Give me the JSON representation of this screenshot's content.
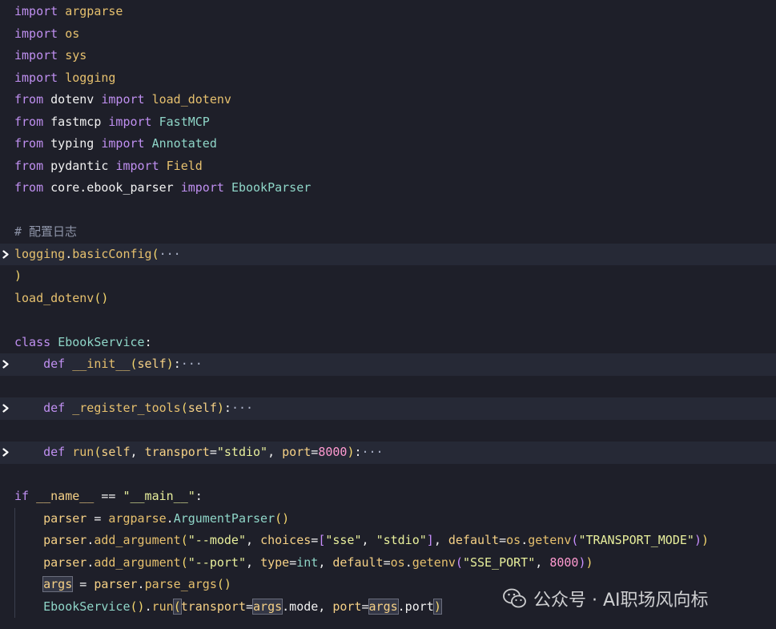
{
  "theme": {
    "background": "#1e1f29",
    "highlight_line": "#262936",
    "keyword": "#bf8ff0",
    "text": "#f1f1f1",
    "module": "#e6c06e",
    "class_name": "#8fd6c8",
    "function": "#e6c06e",
    "parameter": "#f6d186",
    "string": "#e8ef9c",
    "number": "#ff9ad0",
    "comment": "#8e94a8",
    "builtin": "#8fd6c8",
    "operator": "#f1f1f1",
    "bracket": "#f5d76e",
    "bracket_inner": "#c98fff",
    "bracket_innermost": "#5fb3ff"
  },
  "lines": [
    {
      "fold": false,
      "indent": 0,
      "tokens": [
        {
          "t": "import",
          "c": "keyword"
        },
        {
          "t": " "
        },
        {
          "t": "argparse",
          "c": "module"
        }
      ]
    },
    {
      "fold": false,
      "indent": 0,
      "tokens": [
        {
          "t": "import",
          "c": "keyword"
        },
        {
          "t": " "
        },
        {
          "t": "os",
          "c": "module"
        }
      ]
    },
    {
      "fold": false,
      "indent": 0,
      "tokens": [
        {
          "t": "import",
          "c": "keyword"
        },
        {
          "t": " "
        },
        {
          "t": "sys",
          "c": "module"
        }
      ]
    },
    {
      "fold": false,
      "indent": 0,
      "tokens": [
        {
          "t": "import",
          "c": "keyword"
        },
        {
          "t": " "
        },
        {
          "t": "logging",
          "c": "module"
        }
      ]
    },
    {
      "fold": false,
      "indent": 0,
      "tokens": [
        {
          "t": "from",
          "c": "keyword"
        },
        {
          "t": " dotenv "
        },
        {
          "t": "import",
          "c": "keyword"
        },
        {
          "t": " "
        },
        {
          "t": "load_dotenv",
          "c": "function"
        }
      ]
    },
    {
      "fold": false,
      "indent": 0,
      "tokens": [
        {
          "t": "from",
          "c": "keyword"
        },
        {
          "t": " fastmcp "
        },
        {
          "t": "import",
          "c": "keyword"
        },
        {
          "t": " "
        },
        {
          "t": "FastMCP",
          "c": "class_name"
        }
      ]
    },
    {
      "fold": false,
      "indent": 0,
      "tokens": [
        {
          "t": "from",
          "c": "keyword"
        },
        {
          "t": " typing "
        },
        {
          "t": "import",
          "c": "keyword"
        },
        {
          "t": " "
        },
        {
          "t": "Annotated",
          "c": "class_name"
        }
      ]
    },
    {
      "fold": false,
      "indent": 0,
      "tokens": [
        {
          "t": "from",
          "c": "keyword"
        },
        {
          "t": " pydantic "
        },
        {
          "t": "import",
          "c": "keyword"
        },
        {
          "t": " "
        },
        {
          "t": "Field",
          "c": "function"
        }
      ]
    },
    {
      "fold": false,
      "indent": 0,
      "tokens": [
        {
          "t": "from",
          "c": "keyword"
        },
        {
          "t": " core.ebook_parser "
        },
        {
          "t": "import",
          "c": "keyword"
        },
        {
          "t": " "
        },
        {
          "t": "EbookParser",
          "c": "class_name"
        }
      ]
    },
    {
      "fold": false,
      "indent": 0,
      "tokens": []
    },
    {
      "fold": false,
      "indent": 0,
      "tokens": [
        {
          "t": "# 配置日志",
          "c": "comment"
        }
      ]
    },
    {
      "fold": true,
      "highlight": true,
      "indent": 0,
      "tokens": [
        {
          "t": "logging",
          "c": "module"
        },
        {
          "t": "."
        },
        {
          "t": "basicConfig",
          "c": "function"
        },
        {
          "t": "(",
          "c": "bracket"
        },
        {
          "t": "···",
          "c": "ellipsis"
        }
      ]
    },
    {
      "fold": false,
      "indent": 0,
      "tokens": [
        {
          "t": ")",
          "c": "bracket"
        }
      ]
    },
    {
      "fold": false,
      "indent": 0,
      "tokens": [
        {
          "t": "load_dotenv",
          "c": "function"
        },
        {
          "t": "()",
          "c": "bracket"
        }
      ]
    },
    {
      "fold": false,
      "indent": 0,
      "tokens": []
    },
    {
      "fold": false,
      "indent": 0,
      "tokens": [
        {
          "t": "class",
          "c": "keyword"
        },
        {
          "t": " "
        },
        {
          "t": "EbookService",
          "c": "class_name"
        },
        {
          "t": ":"
        }
      ]
    },
    {
      "fold": true,
      "highlight": true,
      "indent": 1,
      "tokens": [
        {
          "t": "    "
        },
        {
          "t": "def",
          "c": "keyword"
        },
        {
          "t": " "
        },
        {
          "t": "__init__",
          "c": "function"
        },
        {
          "t": "(",
          "c": "bracket"
        },
        {
          "t": "self",
          "c": "parameter"
        },
        {
          "t": ")",
          "c": "bracket"
        },
        {
          "t": ":"
        },
        {
          "t": "···",
          "c": "ellipsis"
        }
      ]
    },
    {
      "fold": false,
      "indent": 0,
      "tokens": []
    },
    {
      "fold": true,
      "highlight": true,
      "indent": 1,
      "tokens": [
        {
          "t": "    "
        },
        {
          "t": "def",
          "c": "keyword"
        },
        {
          "t": " "
        },
        {
          "t": "_register_tools",
          "c": "function"
        },
        {
          "t": "(",
          "c": "bracket"
        },
        {
          "t": "self",
          "c": "parameter"
        },
        {
          "t": ")",
          "c": "bracket"
        },
        {
          "t": ":"
        },
        {
          "t": "···",
          "c": "ellipsis"
        }
      ]
    },
    {
      "fold": false,
      "indent": 0,
      "tokens": []
    },
    {
      "fold": true,
      "highlight": true,
      "indent": 1,
      "tokens": [
        {
          "t": "    "
        },
        {
          "t": "def",
          "c": "keyword"
        },
        {
          "t": " "
        },
        {
          "t": "run",
          "c": "function"
        },
        {
          "t": "(",
          "c": "bracket"
        },
        {
          "t": "self",
          "c": "parameter"
        },
        {
          "t": ", "
        },
        {
          "t": "transport",
          "c": "parameter"
        },
        {
          "t": "="
        },
        {
          "t": "\"stdio\"",
          "c": "string"
        },
        {
          "t": ", "
        },
        {
          "t": "port",
          "c": "parameter"
        },
        {
          "t": "="
        },
        {
          "t": "8000",
          "c": "number"
        },
        {
          "t": ")",
          "c": "bracket"
        },
        {
          "t": ":"
        },
        {
          "t": "···",
          "c": "ellipsis"
        }
      ]
    },
    {
      "fold": false,
      "indent": 0,
      "tokens": []
    },
    {
      "fold": false,
      "indent": 0,
      "tokens": [
        {
          "t": "if",
          "c": "keyword"
        },
        {
          "t": " "
        },
        {
          "t": "__name__",
          "c": "parameter"
        },
        {
          "t": " == "
        },
        {
          "t": "\"__main__\"",
          "c": "string"
        },
        {
          "t": ":"
        }
      ]
    },
    {
      "fold": false,
      "indent": 1,
      "tokens": [
        {
          "t": "    "
        },
        {
          "t": "parser",
          "c": "parameter"
        },
        {
          "t": " = "
        },
        {
          "t": "argparse",
          "c": "module"
        },
        {
          "t": "."
        },
        {
          "t": "ArgumentParser",
          "c": "class_name"
        },
        {
          "t": "()",
          "c": "bracket"
        }
      ]
    },
    {
      "fold": false,
      "indent": 1,
      "tokens": [
        {
          "t": "    "
        },
        {
          "t": "parser",
          "c": "parameter"
        },
        {
          "t": "."
        },
        {
          "t": "add_argument",
          "c": "function"
        },
        {
          "t": "(",
          "c": "bracket"
        },
        {
          "t": "\"--mode\"",
          "c": "string"
        },
        {
          "t": ", "
        },
        {
          "t": "choices",
          "c": "parameter"
        },
        {
          "t": "="
        },
        {
          "t": "[",
          "c": "bracket_inner"
        },
        {
          "t": "\"sse\"",
          "c": "string"
        },
        {
          "t": ", "
        },
        {
          "t": "\"stdio\"",
          "c": "string"
        },
        {
          "t": "]",
          "c": "bracket_inner"
        },
        {
          "t": ", "
        },
        {
          "t": "default",
          "c": "parameter"
        },
        {
          "t": "="
        },
        {
          "t": "os",
          "c": "module"
        },
        {
          "t": "."
        },
        {
          "t": "getenv",
          "c": "function"
        },
        {
          "t": "(",
          "c": "bracket_inner"
        },
        {
          "t": "\"TRANSPORT_MODE\"",
          "c": "string"
        },
        {
          "t": ")",
          "c": "bracket_inner"
        },
        {
          "t": ")",
          "c": "bracket"
        }
      ]
    },
    {
      "fold": false,
      "indent": 1,
      "tokens": [
        {
          "t": "    "
        },
        {
          "t": "parser",
          "c": "parameter"
        },
        {
          "t": "."
        },
        {
          "t": "add_argument",
          "c": "function"
        },
        {
          "t": "(",
          "c": "bracket"
        },
        {
          "t": "\"--port\"",
          "c": "string"
        },
        {
          "t": ", "
        },
        {
          "t": "type",
          "c": "parameter"
        },
        {
          "t": "="
        },
        {
          "t": "int",
          "c": "builtin"
        },
        {
          "t": ", "
        },
        {
          "t": "default",
          "c": "parameter"
        },
        {
          "t": "="
        },
        {
          "t": "os",
          "c": "module"
        },
        {
          "t": "."
        },
        {
          "t": "getenv",
          "c": "function"
        },
        {
          "t": "(",
          "c": "bracket_inner"
        },
        {
          "t": "\"SSE_PORT\"",
          "c": "string"
        },
        {
          "t": ", "
        },
        {
          "t": "8000",
          "c": "number"
        },
        {
          "t": ")",
          "c": "bracket_inner"
        },
        {
          "t": ")",
          "c": "bracket"
        }
      ]
    },
    {
      "fold": false,
      "indent": 1,
      "tokens": [
        {
          "t": "    "
        },
        {
          "t": "args",
          "c": "parameter",
          "box": true
        },
        {
          "t": " = "
        },
        {
          "t": "parser",
          "c": "parameter"
        },
        {
          "t": "."
        },
        {
          "t": "parse_args",
          "c": "function"
        },
        {
          "t": "()",
          "c": "bracket"
        }
      ]
    },
    {
      "fold": false,
      "indent": 1,
      "tokens": [
        {
          "t": "    "
        },
        {
          "t": "EbookService",
          "c": "class_name"
        },
        {
          "t": "()",
          "c": "bracket"
        },
        {
          "t": "."
        },
        {
          "t": "run",
          "c": "function"
        },
        {
          "t": "(",
          "c": "bracket",
          "box": true
        },
        {
          "t": "transport",
          "c": "parameter"
        },
        {
          "t": "="
        },
        {
          "t": "args",
          "c": "parameter",
          "box": true
        },
        {
          "t": ".mode, "
        },
        {
          "t": "port",
          "c": "parameter"
        },
        {
          "t": "="
        },
        {
          "t": "args",
          "c": "parameter",
          "box": true
        },
        {
          "t": ".port"
        },
        {
          "t": ")",
          "c": "bracket",
          "box": true
        }
      ]
    }
  ],
  "watermark": {
    "text": "公众号 · AI职场风向标",
    "icon": "wechat-icon"
  }
}
